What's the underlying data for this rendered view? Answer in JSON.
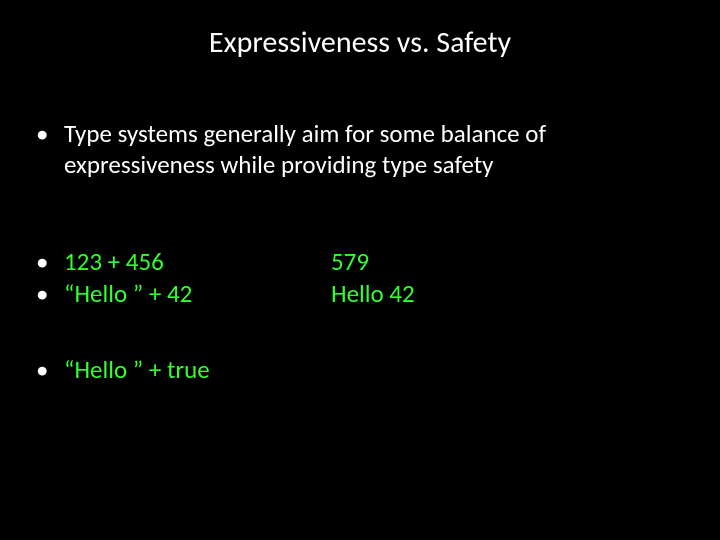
{
  "title": "Expressiveness vs. Safety",
  "intro": "Type systems generally aim for some balance of expressiveness while providing type safety",
  "examples": {
    "row1": {
      "expr": "123 + 456",
      "result": "579"
    },
    "row2": {
      "expr": "“Hello ” + 42",
      "result": "Hello 42"
    },
    "row3": {
      "expr": "“Hello ” + true",
      "result": ""
    }
  },
  "bullet": "•"
}
